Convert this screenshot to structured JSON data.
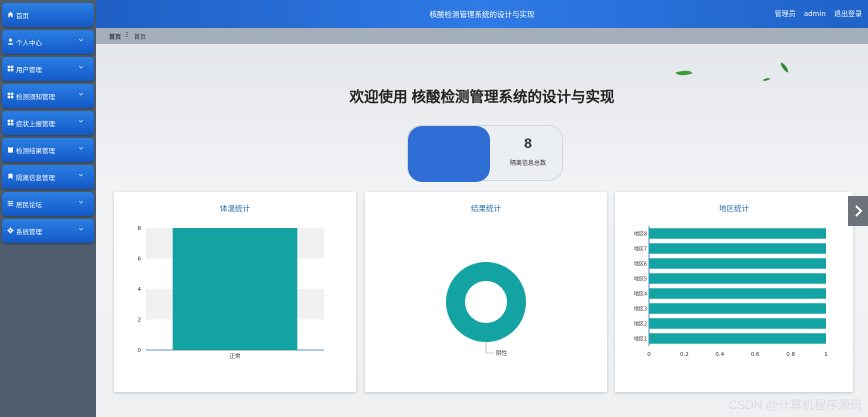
{
  "sidebar": {
    "items": [
      {
        "label": "首页",
        "icon": "home-icon",
        "chevron": false
      },
      {
        "label": "个人中心",
        "icon": "user-icon",
        "chevron": true
      },
      {
        "label": "用户管理",
        "icon": "grid-icon",
        "chevron": true
      },
      {
        "label": "检测须知管理",
        "icon": "grid-icon",
        "chevron": true
      },
      {
        "label": "症状上报管理",
        "icon": "grid-icon",
        "chevron": true
      },
      {
        "label": "检测结果管理",
        "icon": "clipboard-icon",
        "chevron": true
      },
      {
        "label": "隔离信息管理",
        "icon": "bookmark-icon",
        "chevron": true
      },
      {
        "label": "居民论坛",
        "icon": "sliders-icon",
        "chevron": true
      },
      {
        "label": "系统管理",
        "icon": "gear-icon",
        "chevron": true
      }
    ]
  },
  "header": {
    "title": "核酸检测管理系统的设计与实现",
    "user_role": "管理员",
    "username": "admin",
    "logout": "退出登录"
  },
  "breadcrumb": {
    "home": "首页",
    "separator": "Ξ",
    "current": "首页"
  },
  "main": {
    "welcome": "欢迎使用 核酸检测管理系统的设计与实现",
    "stat": {
      "value": "8",
      "label": "隔离信息总数",
      "color": "#2f6ed5"
    }
  },
  "accent_color": "#14a3a3",
  "chart_data": [
    {
      "type": "bar",
      "title": "体温统计",
      "categories": [
        "正常"
      ],
      "values": [
        8
      ],
      "ylim": [
        0,
        8
      ],
      "yticks": [
        "0",
        "2",
        "4",
        "6",
        "8"
      ]
    },
    {
      "type": "pie",
      "title": "结果统计",
      "donut": true,
      "slices": [
        {
          "label": "阴性",
          "value": 8
        }
      ]
    },
    {
      "type": "bar",
      "orientation": "horizontal",
      "title": "地区统计",
      "categories": [
        "地区1",
        "地区2",
        "地区3",
        "地区4",
        "地区5",
        "地区6",
        "地区7",
        "地区8"
      ],
      "values": [
        1,
        1,
        1,
        1,
        1,
        1,
        1,
        1
      ],
      "xlim": [
        0,
        1
      ],
      "xticks": [
        "0",
        "0.2",
        "0.4",
        "0.6",
        "0.8",
        "1"
      ]
    }
  ],
  "watermark": "CSDN @计算机程序源码"
}
